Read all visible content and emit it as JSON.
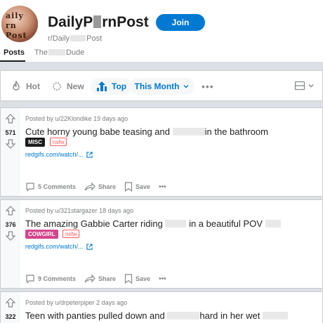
{
  "subreddit": {
    "title_a": "DailyP",
    "title_b": "rnPost",
    "name_a": "r/Daily",
    "name_b": "Post",
    "avatar_text": "aily\nrn\nPost",
    "join_label": "Join"
  },
  "tabs": [
    {
      "label": "Posts",
      "active": true
    },
    {
      "label_a": "The",
      "label_b": "Dude",
      "active": false
    }
  ],
  "sort": {
    "hot": "Hot",
    "new": "New",
    "top": "Top",
    "period": "This Month",
    "more": "•••"
  },
  "posts": [
    {
      "meta": "Posted by u/22Klondike 19 days ago",
      "score": "571",
      "title_a": "Cute horny young babe teasing and",
      "title_b": "in the bathroom",
      "flair": "MISC",
      "flair_color": "#1c1c1c",
      "nsfw": "nsfw",
      "link": "redgifs.com/watch/...",
      "comments": "5 Comments",
      "share": "Share",
      "save": "Save",
      "more": "•••"
    },
    {
      "meta": "Posted by u/321stargazer 18 days ago",
      "score": "376",
      "title_a": "The amazing Gabbie Carter riding",
      "title_b": "in a beautiful POV",
      "flair": "COWGIRL",
      "flair_color": "#d4458c",
      "nsfw": "nsfw",
      "link": "redgifs.com/watch/...",
      "comments": "9 Comments",
      "share": "Share",
      "save": "Save",
      "more": "•••"
    },
    {
      "meta": "Posted by u/drpeterpiper 2 days ago",
      "score": "322",
      "title_a": "Teen with panties pulled down and",
      "title_b": "hard in her wet"
    }
  ],
  "colors": {
    "accent": "#0079d3",
    "background": "#dae0e6",
    "nsfw": "#ff585b"
  }
}
